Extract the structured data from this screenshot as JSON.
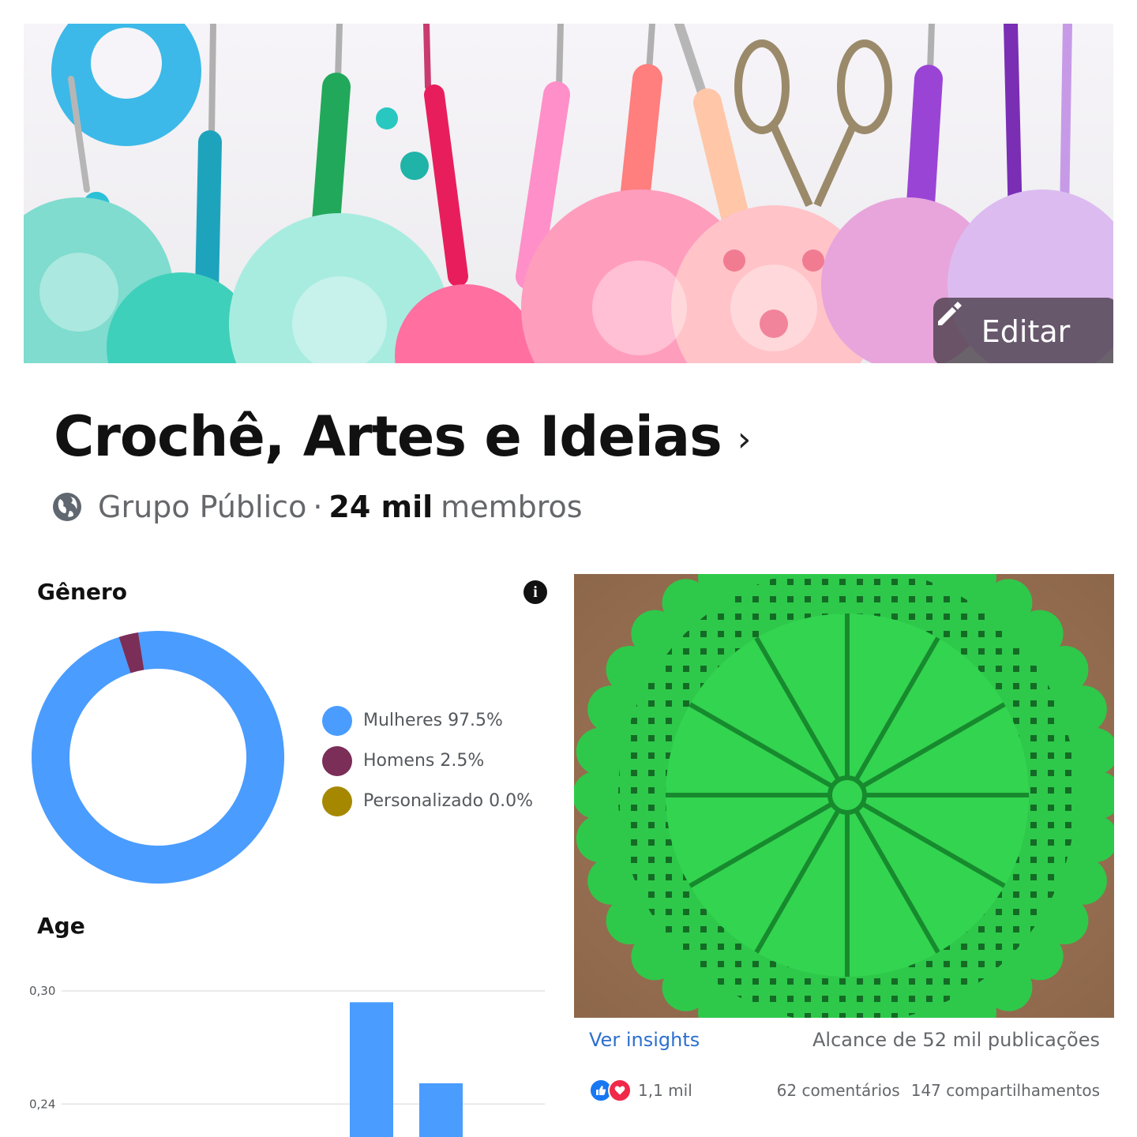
{
  "cover": {
    "edit_label": "Editar",
    "edit_icon": "pencil-icon"
  },
  "group": {
    "name": "Crochê, Artes e Ideias",
    "chevron": "›",
    "privacy": "Grupo Público",
    "separator": "·",
    "member_count": "24 mil",
    "member_word": "membros"
  },
  "gender": {
    "title": "Gênero",
    "info_icon": "info-icon",
    "legend": [
      {
        "label": "Mulheres 97.5%",
        "value": 97.5,
        "color": "#4a9cff"
      },
      {
        "label": "Homens 2.5%",
        "value": 2.5,
        "color": "#7a2e58"
      },
      {
        "label": "Personalizado 0.0%",
        "value": 0.0,
        "color": "#a68800"
      }
    ]
  },
  "age": {
    "title": "Age"
  },
  "chart_data": {
    "type": "bar",
    "ylim": [
      0.22,
      0.3
    ],
    "yticks": [
      "0,30",
      "0,24"
    ],
    "grid": true,
    "values": [
      0.294,
      0.251
    ],
    "color": "#4a9cff"
  },
  "post": {
    "insights_link": "Ver insights",
    "reach": "Alcance de 52 mil publicações",
    "reaction_count": "1,1 mil",
    "comments": "62 comentários",
    "shares": "147 compartilhamentos"
  }
}
